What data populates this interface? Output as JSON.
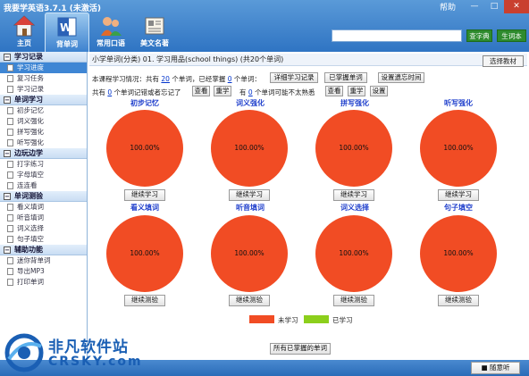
{
  "window": {
    "title": "我要学英语3.7.1 (未激活)",
    "help": "帮助",
    "minimize": "—",
    "maximize": "□",
    "close": "✕"
  },
  "nav": [
    {
      "label": "主页",
      "icon": "home-icon"
    },
    {
      "label": "背单词",
      "icon": "word-icon"
    },
    {
      "label": "常用口语",
      "icon": "people-icon"
    },
    {
      "label": "美文名著",
      "icon": "newspaper-icon"
    }
  ],
  "search": {
    "placeholder": "",
    "lookup_label": "查字典",
    "vocab_label": "生词本"
  },
  "sidebar": {
    "sections": [
      {
        "title": "学习记录",
        "items": [
          "学习进度",
          "复习任务",
          "学习记录"
        ]
      },
      {
        "title": "单词学习",
        "items": [
          "初步记忆",
          "词义强化",
          "拼写强化",
          "听写强化"
        ]
      },
      {
        "title": "边玩边学",
        "items": [
          "打字练习",
          "字母填空",
          "连连看"
        ]
      },
      {
        "title": "单词测验",
        "items": [
          "看义填词",
          "听音填词",
          "词义选择",
          "句子填空"
        ]
      },
      {
        "title": "辅助功能",
        "items": [
          "迷你背单词",
          "导出MP3",
          "打印单词"
        ]
      }
    ]
  },
  "main": {
    "title": "小学单词(分类) 01. 学习用品(school things) (共20个单词)",
    "choose_label": "选择教材",
    "line1": {
      "a": "本课程学习情况：共有",
      "total": "20",
      "b": "个单词，已经掌握",
      "mastered": "0",
      "c": "个单词："
    },
    "line2": {
      "a": "共有",
      "forgot": "0",
      "b": "个单词记错或者忘记了",
      "d": "有",
      "unfamiliar": "0",
      "e": "个单词可能不太熟悉"
    },
    "buttons": {
      "detail": "详细学习记录",
      "mastered_words": "已掌握单词",
      "set_review": "设置遗忘时间",
      "view1": "查看",
      "relearn1": "重学",
      "view2": "查看",
      "relearn2": "重学",
      "settings": "设置",
      "all_mastered": "所有已掌握的单词"
    },
    "legend": {
      "unlearned": "未学习",
      "learned": "已学习"
    }
  },
  "chart_data": {
    "type": "pie",
    "colors": {
      "unlearned": "#f14c24",
      "learned": "#8ccf1c"
    },
    "charts": [
      {
        "title": "初步记忆",
        "unlearned": 100,
        "learned": 0,
        "label": "100.00%",
        "button": "继续学习"
      },
      {
        "title": "词义强化",
        "unlearned": 100,
        "learned": 0,
        "label": "100.00%",
        "button": "继续学习"
      },
      {
        "title": "拼写强化",
        "unlearned": 100,
        "learned": 0,
        "label": "100.00%",
        "button": "继续学习"
      },
      {
        "title": "听写强化",
        "unlearned": 100,
        "learned": 0,
        "label": "100.00%",
        "button": "继续学习"
      },
      {
        "title": "看义填词",
        "unlearned": 100,
        "learned": 0,
        "label": "100.00%",
        "button": "继续测验"
      },
      {
        "title": "听音填词",
        "unlearned": 100,
        "learned": 0,
        "label": "100.00%",
        "button": "继续测验"
      },
      {
        "title": "词义选择",
        "unlearned": 100,
        "learned": 0,
        "label": "100.00%",
        "button": "继续测验"
      },
      {
        "title": "句子填空",
        "unlearned": 100,
        "learned": 0,
        "label": "100.00%",
        "button": "继续测验"
      }
    ]
  },
  "footer": {
    "random_label": "随意听"
  },
  "watermark": {
    "text": "非凡软件站",
    "url": "CRSKY.com"
  }
}
